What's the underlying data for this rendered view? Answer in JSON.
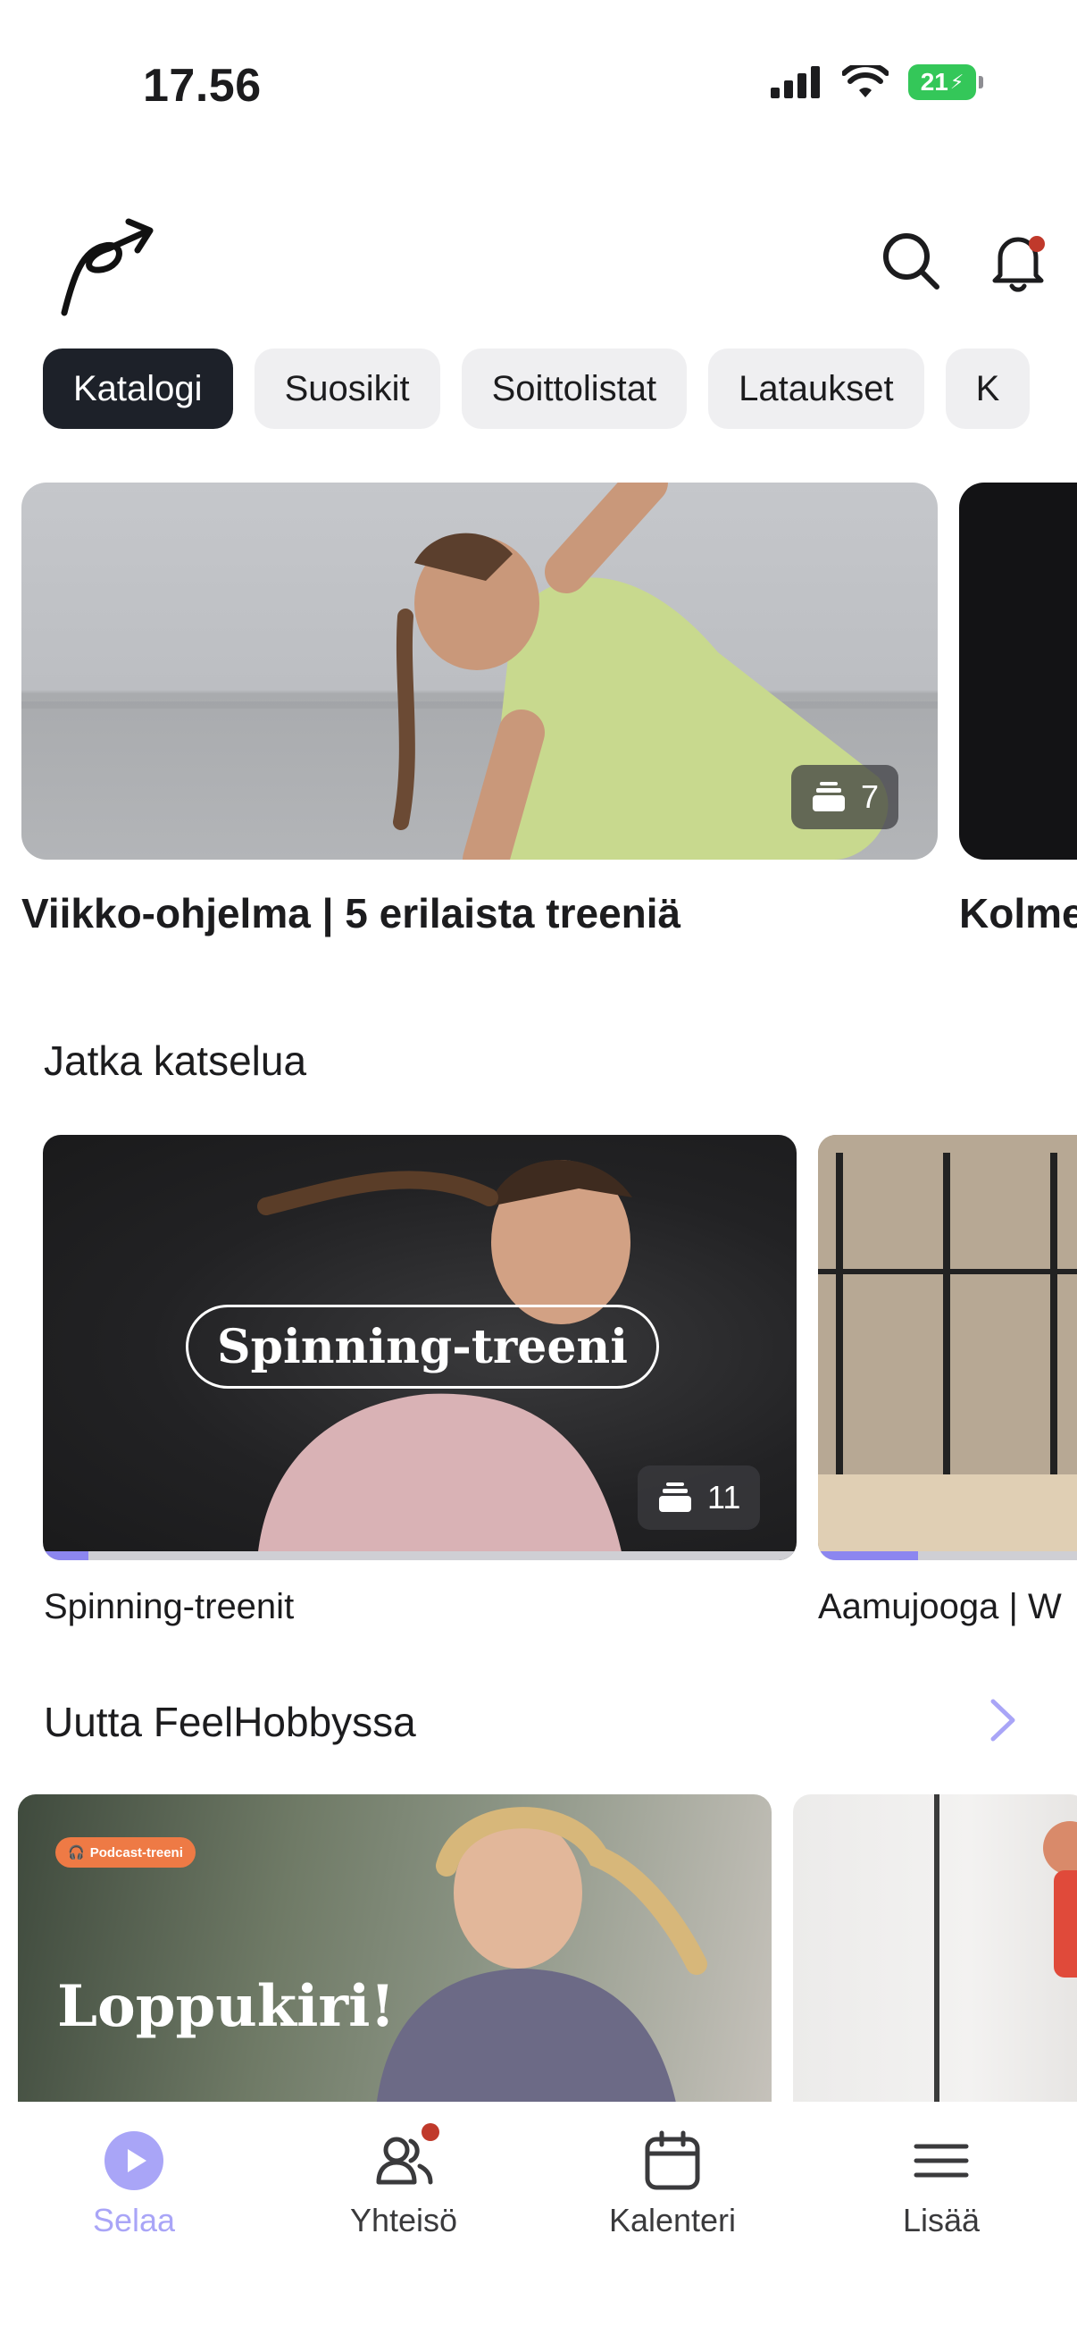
{
  "status_bar": {
    "time": "17.56",
    "battery": "21",
    "icons": [
      "signal-icon",
      "wifi-icon",
      "battery-icon"
    ]
  },
  "header": {
    "icons": [
      "feelhobby-logo-icon",
      "search-icon",
      "bell-icon"
    ],
    "has_notification": true
  },
  "tabs": [
    {
      "label": "Katalogi",
      "active": true
    },
    {
      "label": "Suosikit",
      "active": false
    },
    {
      "label": "Soittolistat",
      "active": false
    },
    {
      "label": "Lataukset",
      "active": false
    },
    {
      "label": "K",
      "active": false
    }
  ],
  "hero": {
    "items": [
      {
        "title": "Viikko-ohjelma | 5 erilaista treeniä",
        "count": "7"
      },
      {
        "title": "Kolme"
      }
    ]
  },
  "continue_watching": {
    "title": "Jatka katselua",
    "items": [
      {
        "overlay": "Spinning-treeni",
        "count": "11",
        "caption": "Spinning-treenit",
        "progress": 0.06
      },
      {
        "caption": "Aamujooga | W",
        "progress": 0.35
      }
    ]
  },
  "new_section": {
    "title": "Uutta FeelHobbyssa",
    "items": [
      {
        "badge": "Podcast-treeni",
        "title": "Loppukiri!"
      },
      {}
    ]
  },
  "bottom_nav": [
    {
      "label": "Selaa",
      "icon": "play-circle-icon",
      "active": true
    },
    {
      "label": "Yhteisö",
      "icon": "community-icon",
      "badge": true
    },
    {
      "label": "Kalenteri",
      "icon": "calendar-icon"
    },
    {
      "label": "Lisää",
      "icon": "menu-icon"
    }
  ],
  "colors": {
    "accent": "#a9a5f7",
    "active_tab": "#1d2129",
    "notification": "#c0392b",
    "podcast_badge": "#ee7a45"
  }
}
